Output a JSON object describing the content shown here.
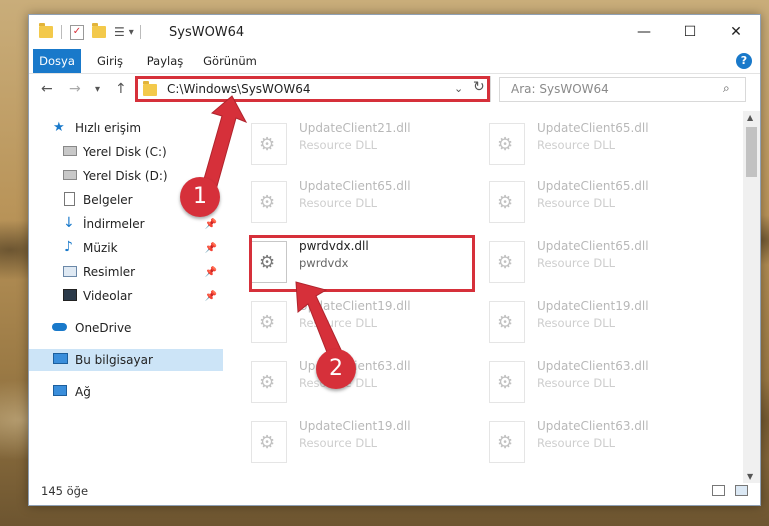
{
  "window": {
    "title": "SysWOW64",
    "controls": {
      "minimize": "—",
      "maximize": "☐",
      "close": "✕"
    }
  },
  "ribbon": {
    "tabs": [
      "Dosya",
      "Giriş",
      "Paylaş",
      "Görünüm"
    ],
    "help": "?"
  },
  "address": {
    "path": "C:\\Windows\\SysWOW64",
    "search_placeholder": "Ara: SysWOW64"
  },
  "sidebar": {
    "items": [
      {
        "label": "Hızlı erişim",
        "icon": "star-icon"
      },
      {
        "label": "Yerel Disk (C:)",
        "icon": "drive-icon"
      },
      {
        "label": "Yerel Disk (D:)",
        "icon": "drive-icon"
      },
      {
        "label": "Belgeler",
        "icon": "document-icon"
      },
      {
        "label": "İndirmeler",
        "icon": "download-icon"
      },
      {
        "label": "Müzik",
        "icon": "music-icon"
      },
      {
        "label": "Resimler",
        "icon": "pictures-icon"
      },
      {
        "label": "Videolar",
        "icon": "video-icon"
      },
      {
        "label": "OneDrive",
        "icon": "cloud-icon"
      },
      {
        "label": "Bu bilgisayar",
        "icon": "computer-icon"
      },
      {
        "label": "Ağ",
        "icon": "network-icon"
      }
    ]
  },
  "files": [
    {
      "name": "UpdateClient21.dll",
      "type": "Resource DLL"
    },
    {
      "name": "UpdateClient65.dll",
      "type": "Resource DLL"
    },
    {
      "name": "UpdateClient65.dll",
      "type": "Resource DLL"
    },
    {
      "name": "UpdateClient65.dll",
      "type": "Resource DLL"
    },
    {
      "name": "pwrdvdx.dll",
      "type": "pwrdvdx"
    },
    {
      "name": "UpdateClient65.dll",
      "type": "Resource DLL"
    },
    {
      "name": "UpdateClient19.dll",
      "type": "Resource DLL"
    },
    {
      "name": "UpdateClient19.dll",
      "type": "Resource DLL"
    },
    {
      "name": "UpdateClient63.dll",
      "type": "Resource DLL"
    },
    {
      "name": "UpdateClient63.dll",
      "type": "Resource DLL"
    },
    {
      "name": "UpdateClient19.dll",
      "type": "Resource DLL"
    },
    {
      "name": "UpdateClient63.dll",
      "type": "Resource DLL"
    }
  ],
  "status": {
    "count": "145 öğe"
  },
  "annotations": {
    "step1": "1",
    "step2": "2",
    "color": "#d6303a"
  }
}
